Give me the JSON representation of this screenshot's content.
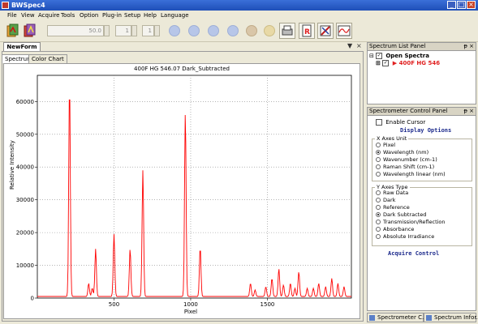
{
  "window": {
    "title": "BWSpec4",
    "controls": [
      "_",
      "□",
      "×"
    ]
  },
  "menu": [
    "File",
    "View",
    "Acquire",
    "Tools",
    "Option",
    "Plug-in",
    "Setup",
    "Help",
    "Language"
  ],
  "toolbar": {
    "integration_value": "50.0",
    "average_value": "1",
    "smooth_value": "1"
  },
  "document": {
    "tab": "NewForm",
    "close": "×",
    "dropdown": "▼"
  },
  "subtabs": [
    "Spectrum",
    "Color Chart"
  ],
  "chart_data": {
    "type": "line",
    "title": "400F HG 546.07      Dark_Subtracted",
    "xlabel": "Pixel",
    "ylabel": "Relative Intensity",
    "xlim": [
      0,
      2048
    ],
    "ylim": [
      0,
      68000
    ],
    "x_ticks": [
      500,
      1000,
      1500
    ],
    "y_ticks": [
      0,
      10000,
      20000,
      30000,
      40000,
      50000,
      60000
    ],
    "grid": true,
    "series": [
      {
        "color": "#ff0000",
        "peaks": [
          {
            "x": 210,
            "y": 65000
          },
          {
            "x": 335,
            "y": 4000
          },
          {
            "x": 358,
            "y": 2500
          },
          {
            "x": 380,
            "y": 14500
          },
          {
            "x": 500,
            "y": 19000
          },
          {
            "x": 605,
            "y": 14500
          },
          {
            "x": 688,
            "y": 38500
          },
          {
            "x": 965,
            "y": 56500
          },
          {
            "x": 1062,
            "y": 15000
          },
          {
            "x": 1390,
            "y": 4000
          },
          {
            "x": 1420,
            "y": 2000
          },
          {
            "x": 1490,
            "y": 3000
          },
          {
            "x": 1530,
            "y": 5500
          },
          {
            "x": 1575,
            "y": 8500
          },
          {
            "x": 1605,
            "y": 3500
          },
          {
            "x": 1650,
            "y": 4000
          },
          {
            "x": 1680,
            "y": 2500
          },
          {
            "x": 1705,
            "y": 7500
          },
          {
            "x": 1760,
            "y": 2500
          },
          {
            "x": 1800,
            "y": 2500
          },
          {
            "x": 1835,
            "y": 4000
          },
          {
            "x": 1880,
            "y": 3000
          },
          {
            "x": 1920,
            "y": 5500
          },
          {
            "x": 1960,
            "y": 4000
          },
          {
            "x": 2000,
            "y": 3000
          }
        ],
        "baseline": 500
      }
    ]
  },
  "spectrum_list_panel": {
    "title": "Spectrum List Panel",
    "root": "Open Spectra",
    "item": "400F HG 546"
  },
  "control_panel": {
    "title": "Spectrometer Control Panel",
    "enable_cursor": "Enable Cursor",
    "display_options": "Display Options",
    "x_axes_unit": {
      "title": "X Axes Unit",
      "options": [
        "Pixel",
        "Wavelength (nm)",
        "Wavenumber (cm-1)",
        "Raman Shift (cm-1)",
        "Wavelength linear (nm)"
      ],
      "selected": 1
    },
    "y_axes_type": {
      "title": "Y Axes Type",
      "options": [
        "Raw Data",
        "Dark",
        "Reference",
        "Dark Subtracted",
        "Transmission/Reflection",
        "Absorbance",
        "Absolute Irradiance"
      ],
      "selected": 3
    },
    "acquire_control": "Acquire Control"
  },
  "bottom_tabs": [
    "Spectrometer C...",
    "Spectrum Infor..."
  ],
  "icon_colors": {
    "accent_red": "#e02020",
    "panel_header": "#d8d4c4"
  }
}
